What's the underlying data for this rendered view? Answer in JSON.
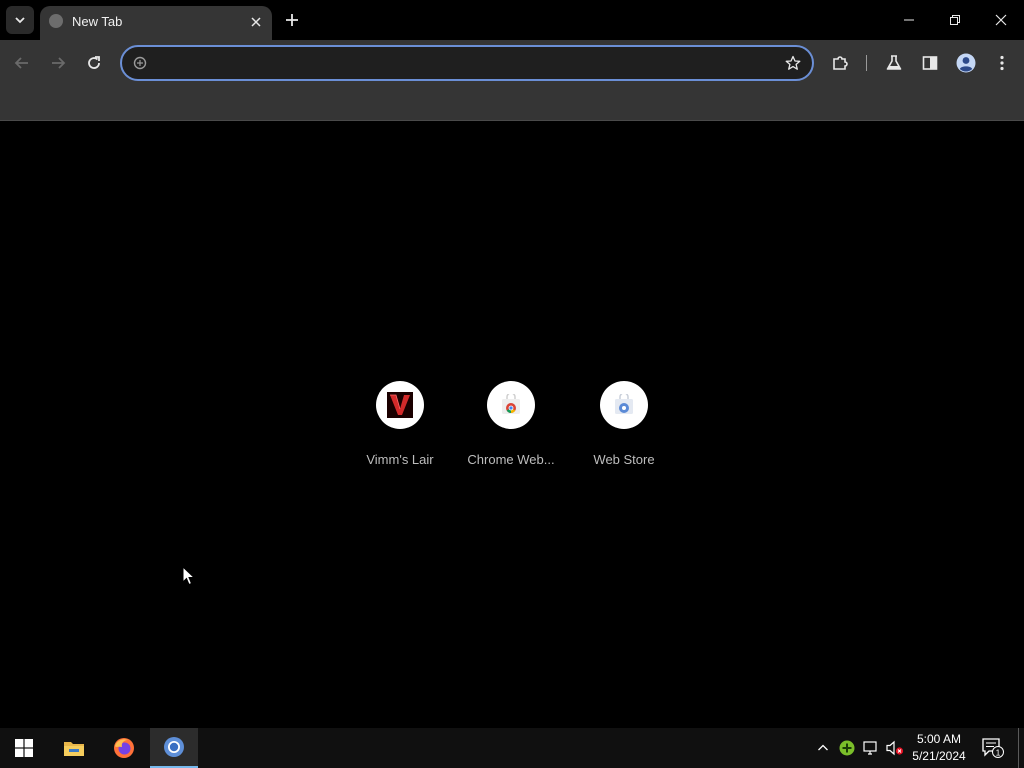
{
  "browser": {
    "tab": {
      "title": "New Tab"
    },
    "omnibox": {
      "value": "",
      "placeholder": ""
    }
  },
  "shortcuts": [
    {
      "label": "Vimm's Lair",
      "icon": "vimms-lair-logo"
    },
    {
      "label": "Chrome Web...",
      "icon": "chrome-web-store-icon"
    },
    {
      "label": "Web Store",
      "icon": "web-store-icon"
    }
  ],
  "taskbar": {
    "apps": [
      "windows-start",
      "file-explorer",
      "firefox",
      "chrome"
    ],
    "clock": {
      "time": "5:00 AM",
      "date": "5/21/2024"
    },
    "notification_count": "1"
  },
  "colors": {
    "focus_ring": "#6b8fd6",
    "toolbar": "#353535",
    "taskbar_accent": "#76b9ed"
  }
}
